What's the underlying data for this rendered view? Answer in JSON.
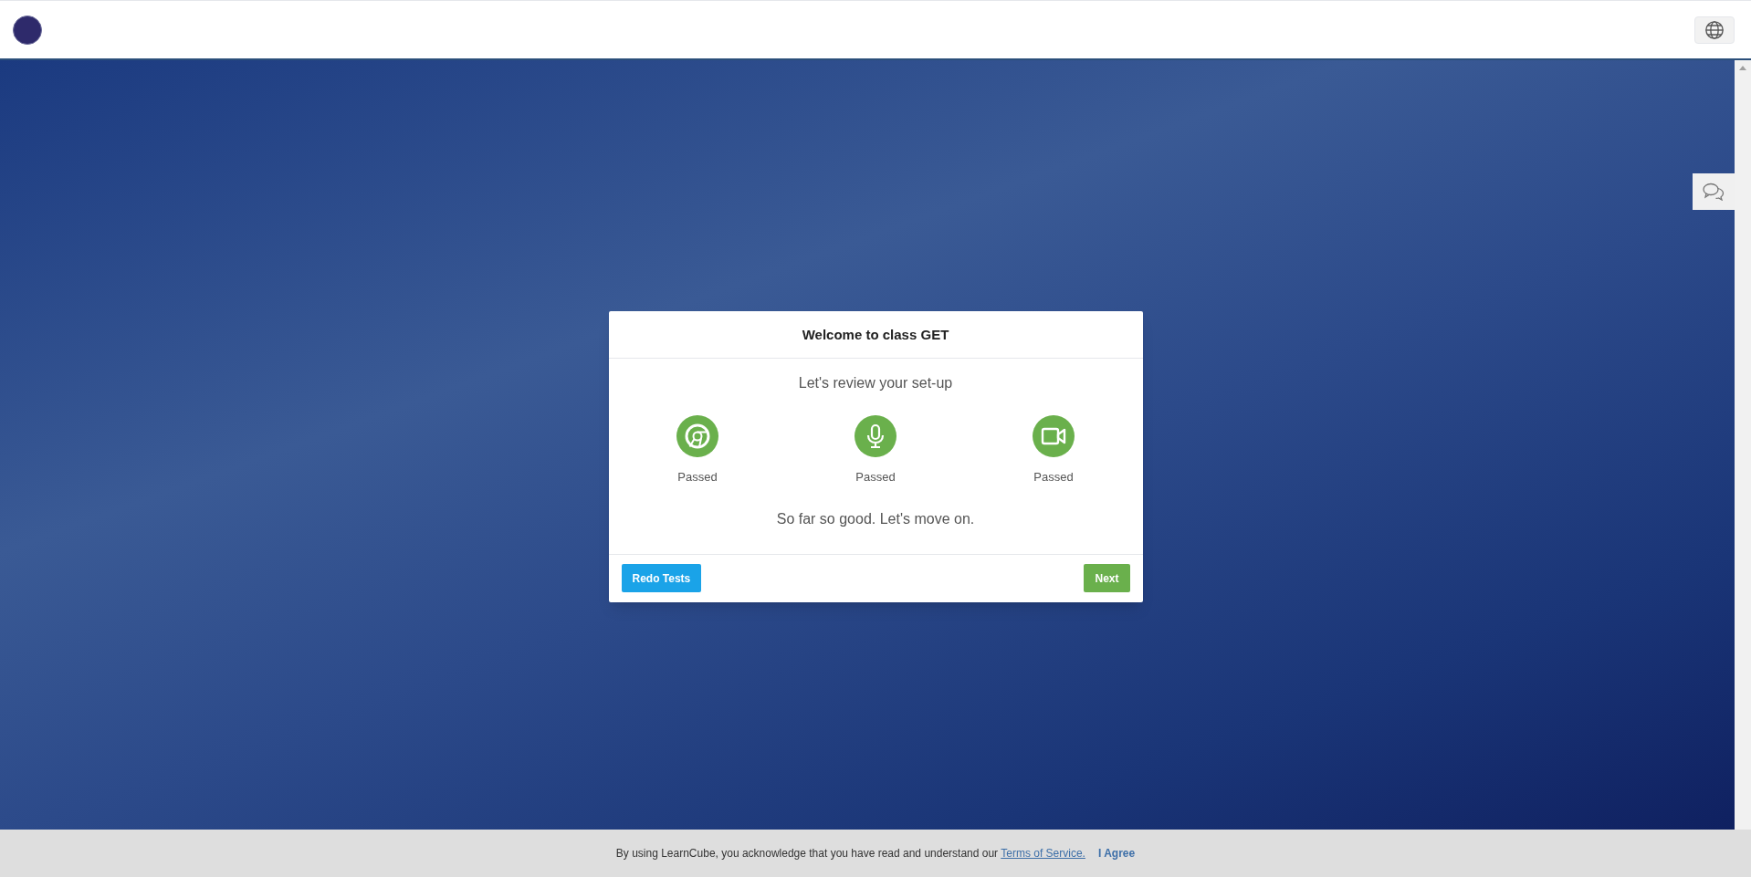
{
  "dialog": {
    "title": "Welcome to class GET",
    "subtitle": "Let's review your set-up",
    "checks": [
      {
        "kind": "browser",
        "status": "Passed"
      },
      {
        "kind": "microphone",
        "status": "Passed"
      },
      {
        "kind": "camera",
        "status": "Passed"
      }
    ],
    "message": "So far so good. Let's move on.",
    "buttons": [
      {
        "kind": "secondary",
        "label": "Redo Tests"
      },
      {
        "kind": "primary",
        "label": "Next"
      }
    ]
  },
  "consent_bar": {
    "text": "By using LearnCube, you acknowledge that you have read and understand our ",
    "link": "Terms of Service.",
    "agree": "I Agree"
  }
}
